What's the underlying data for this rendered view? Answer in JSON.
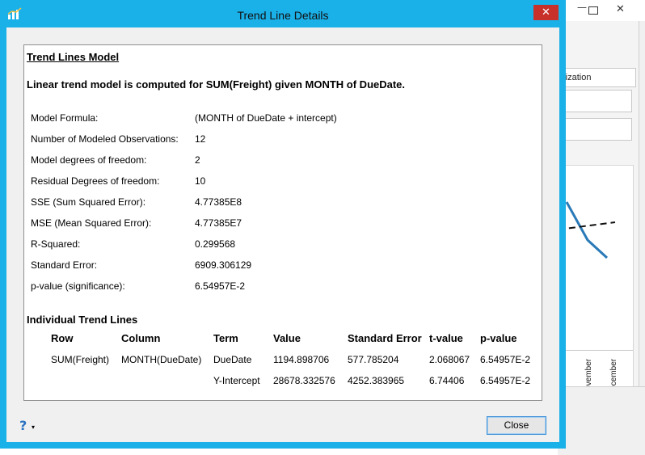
{
  "background_app": {
    "tab_label": "ualization",
    "x_axis_labels": [
      "November",
      "December"
    ],
    "series_color": "#2a7ab8"
  },
  "dialog": {
    "title": "Trend Line Details",
    "close_glyph": "✕",
    "model_heading": "Trend Lines Model",
    "model_description": "Linear trend model is computed for SUM(Freight) given MONTH of DueDate.",
    "stats": [
      {
        "label": "Model Formula:",
        "value": "(MONTH of DueDate + intercept)"
      },
      {
        "label": "Number of Modeled Observations:",
        "value": "12"
      },
      {
        "label": "Model degrees of freedom:",
        "value": "2"
      },
      {
        "label": "Residual Degrees of freedom:",
        "value": "10"
      },
      {
        "label": "SSE (Sum Squared Error):",
        "value": "4.77385E8"
      },
      {
        "label": "MSE (Mean Squared Error):",
        "value": "4.77385E7"
      },
      {
        "label": "R-Squared:",
        "value": "0.299568"
      },
      {
        "label": "Standard Error:",
        "value": "6909.306129"
      },
      {
        "label": "p-value (significance):",
        "value": "6.54957E-2"
      }
    ],
    "individual_heading": "Individual Trend Lines",
    "table": {
      "headers": [
        "Row",
        "Column",
        "Term",
        "Value",
        "Standard Error",
        "t-value",
        "p-value"
      ],
      "rows": [
        [
          "SUM(Freight)",
          "MONTH(DueDate)",
          "DueDate",
          "1194.898706",
          "577.785204",
          "2.068067",
          "6.54957E-2"
        ],
        [
          "",
          "",
          "Y-Intercept",
          "28678.332576",
          "4252.383965",
          "6.74406",
          "6.54957E-2"
        ]
      ]
    },
    "help_glyph": "?",
    "help_caret": "▾",
    "close_button_label": "Close",
    "accent_color": "#1ab0e8"
  }
}
